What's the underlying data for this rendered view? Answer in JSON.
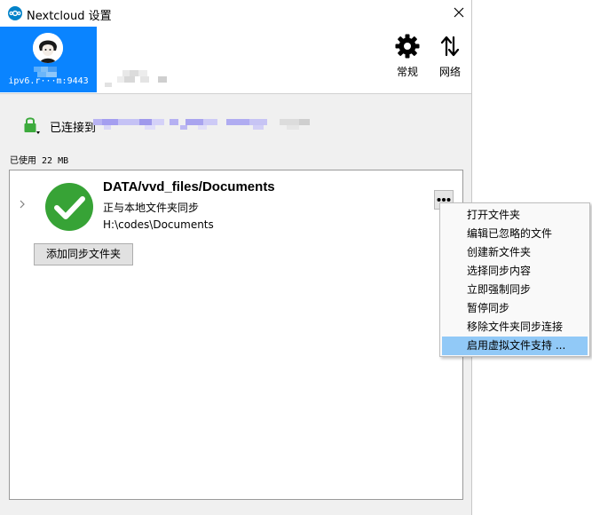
{
  "window": {
    "title": "Nextcloud 设置",
    "icons": {
      "logo": "nextcloud-logo-icon",
      "close": "close-icon"
    }
  },
  "header": {
    "account_tab_label": "ipv6.r···m:9443",
    "nav": [
      {
        "label": "常规",
        "icon": "gear-icon"
      },
      {
        "label": "网络",
        "icon": "up-down-arrows-icon"
      }
    ]
  },
  "status": {
    "connected_label": "已连接到",
    "icon": "lock-icon",
    "accent": "#3daa3d"
  },
  "usage": {
    "label": "已使用 22 MB"
  },
  "folder": {
    "name": "DATA/vvd_files/Documents",
    "status": "正与本地文件夹同步",
    "path": "H:\\codes\\Documents",
    "status_icon": "check-circle-icon",
    "status_color": "#37a336",
    "add_button_label": "添加同步文件夹"
  },
  "context_menu": {
    "items": [
      {
        "label": "打开文件夹"
      },
      {
        "label": "编辑已忽略的文件"
      },
      {
        "label": "创建新文件夹"
      },
      {
        "label": "选择同步内容"
      },
      {
        "label": "立即强制同步"
      },
      {
        "label": "暂停同步"
      },
      {
        "label": "移除文件夹同步连接"
      },
      {
        "label": "启用虚拟文件支持 ...",
        "highlighted": true
      }
    ]
  },
  "colors": {
    "accent": "#0a84ff",
    "highlight": "#91c9f7"
  }
}
